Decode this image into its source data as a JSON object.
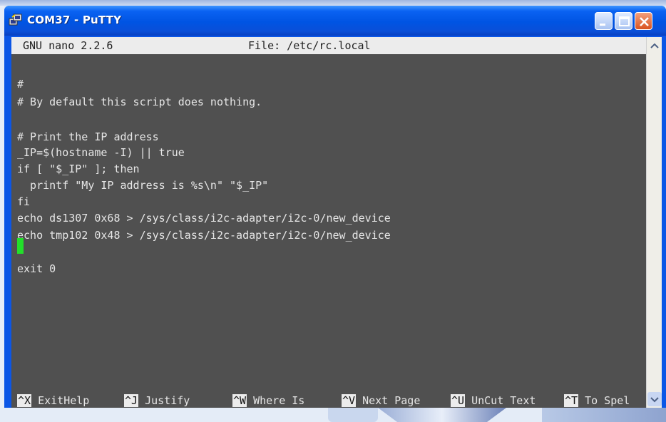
{
  "window": {
    "title": "COM37 - PuTTY",
    "icon": "putty-computer-icon"
  },
  "nano": {
    "version": "GNU nano 2.2.6",
    "file": "File: /etc/rc.local"
  },
  "lines": [
    "#",
    "# By default this script does nothing.",
    "",
    "# Print the IP address",
    "_IP=$(hostname -I) || true",
    "if [ \"$_IP\" ]; then",
    "  printf \"My IP address is %s\\n\" \"$_IP\"",
    "fi",
    "echo ds1307 0x68 > /sys/class/i2c-adapter/i2c-0/new_device",
    "echo tmp102 0x48 > /sys/class/i2c-adapter/i2c-0/new_device",
    "",
    "exit 0"
  ],
  "shortcuts": [
    {
      "key": "^X",
      "label": " ExitHelp"
    },
    {
      "key": "^J",
      "label": " Justify"
    },
    {
      "key": "^W",
      "label": " Where Is"
    },
    {
      "key": "^V",
      "label": " Next Page"
    },
    {
      "key": "^U",
      "label": " UnCut Text"
    },
    {
      "key": "^T",
      "label": " To Spel"
    }
  ],
  "colors": {
    "terminal_bg": "#505050",
    "terminal_fg": "#e6e6e6",
    "cursor": "#22e02a",
    "titlebar": "#0054e3"
  }
}
